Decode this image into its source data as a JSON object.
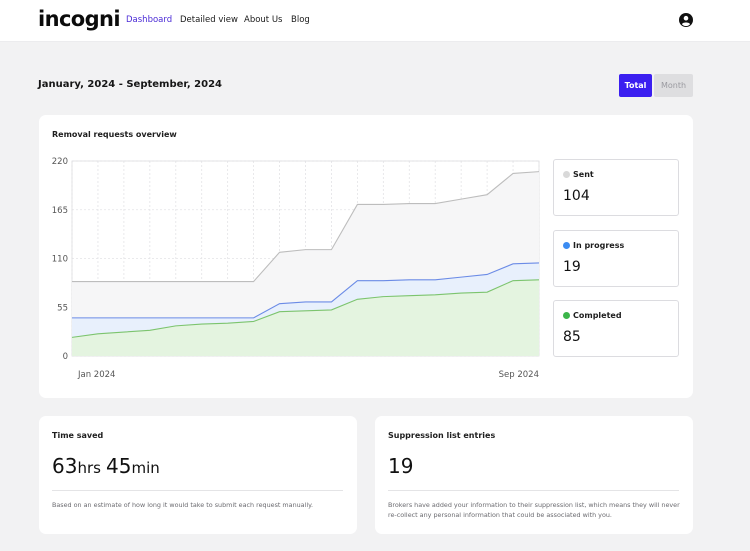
{
  "brand": "incogni",
  "nav": {
    "dashboard": "Dashboard",
    "detailed": "Detailed view",
    "about": "About Us",
    "blog": "Blog",
    "active_color": "#4b2bd6"
  },
  "icons": {
    "user": "user-circle-icon"
  },
  "header": {
    "date_range": "January, 2024 - September, 2024",
    "toggle_total": "Total",
    "toggle_month": "Month",
    "accent": "#3b1ff0"
  },
  "overview": {
    "title": "Removal requests overview",
    "stats": {
      "sent": {
        "label": "Sent",
        "value": "104",
        "color": "#d9d9d9"
      },
      "in_progress": {
        "label": "In progress",
        "value": "19",
        "color": "#3b8cf2"
      },
      "completed": {
        "label": "Completed",
        "value": "85",
        "color": "#3cb54a"
      }
    }
  },
  "chart_data": {
    "type": "area",
    "title": "Removal requests overview",
    "x_tick_labels": [
      "Jan 2024",
      "Sep 2024"
    ],
    "y_ticks": [
      "0",
      "55",
      "110",
      "165",
      "220"
    ],
    "ylim": [
      0,
      220
    ],
    "grid": true,
    "series": [
      {
        "name": "Sent",
        "color": "#bdbdbd",
        "fill": "#f6f6f7",
        "values": [
          84,
          84,
          84,
          84,
          84,
          84,
          84,
          84,
          117,
          120,
          120,
          171,
          171,
          172,
          172,
          177,
          182,
          206,
          208
        ]
      },
      {
        "name": "In progress",
        "color": "#6b8be6",
        "fill": "#e8f0fc",
        "values": [
          43,
          43,
          43,
          43,
          43,
          43,
          43,
          43,
          59,
          61,
          61,
          85,
          85,
          86,
          86,
          89,
          92,
          104,
          105
        ]
      },
      {
        "name": "Completed",
        "color": "#7cc46e",
        "fill": "#e4f4e0",
        "values": [
          21,
          25,
          27,
          29,
          34,
          36,
          37,
          39,
          50,
          51,
          52,
          64,
          67,
          68,
          69,
          71,
          72,
          85,
          86
        ]
      }
    ]
  },
  "time_saved": {
    "title": "Time saved",
    "hours": "63",
    "hours_unit": "hrs",
    "minutes": "45",
    "minutes_unit": "min",
    "desc": "Based on an estimate of how long it would take to submit each request manually."
  },
  "suppression": {
    "title": "Suppression list entries",
    "value": "19",
    "desc": "Brokers have added your information to their suppression list, which means they will never re-collect any personal information that could be associated with you."
  }
}
